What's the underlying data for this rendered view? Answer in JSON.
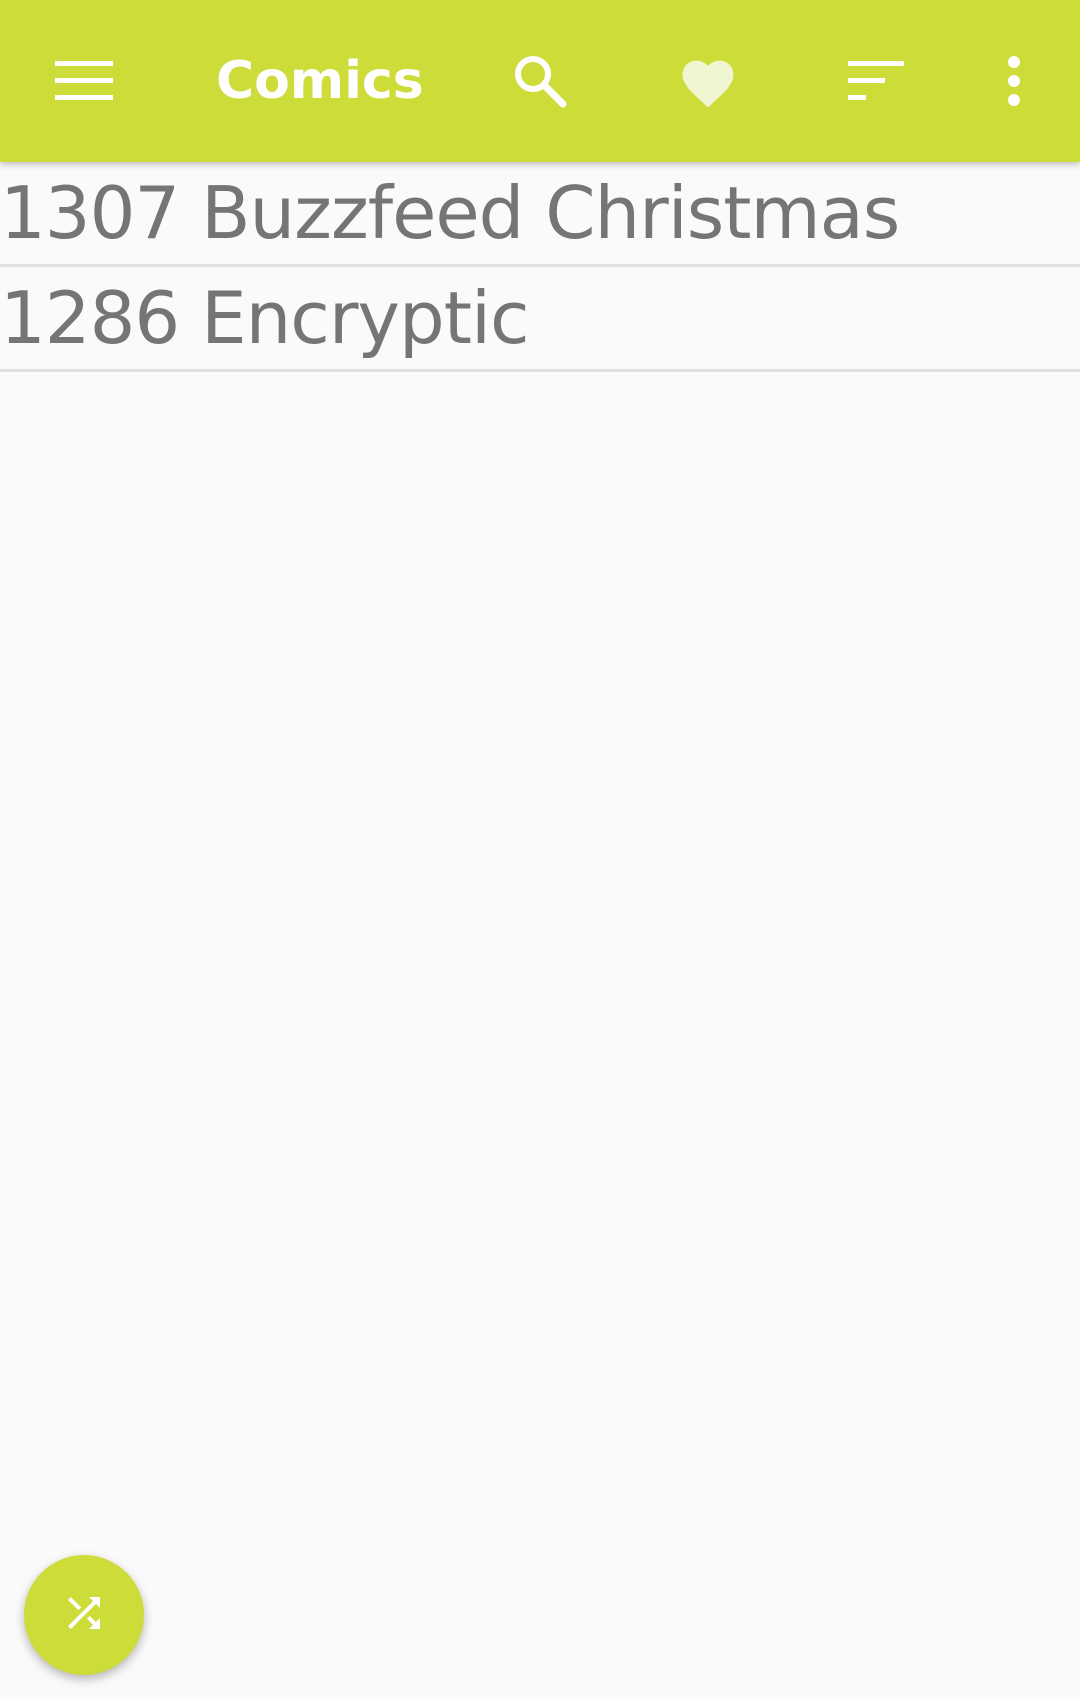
{
  "toolbar": {
    "title": "Comics",
    "background_color": "#cddc39",
    "icons": {
      "menu": "menu-icon",
      "search": "search-icon",
      "favorites": "heart-icon",
      "sort": "sort-icon",
      "overflow": "more-vert-icon"
    }
  },
  "comics": [
    {
      "label": "1307 Buzzfeed Christmas"
    },
    {
      "label": "1286 Encryptic"
    }
  ],
  "fab": {
    "icon": "shuffle-icon",
    "color": "#cddc39"
  }
}
